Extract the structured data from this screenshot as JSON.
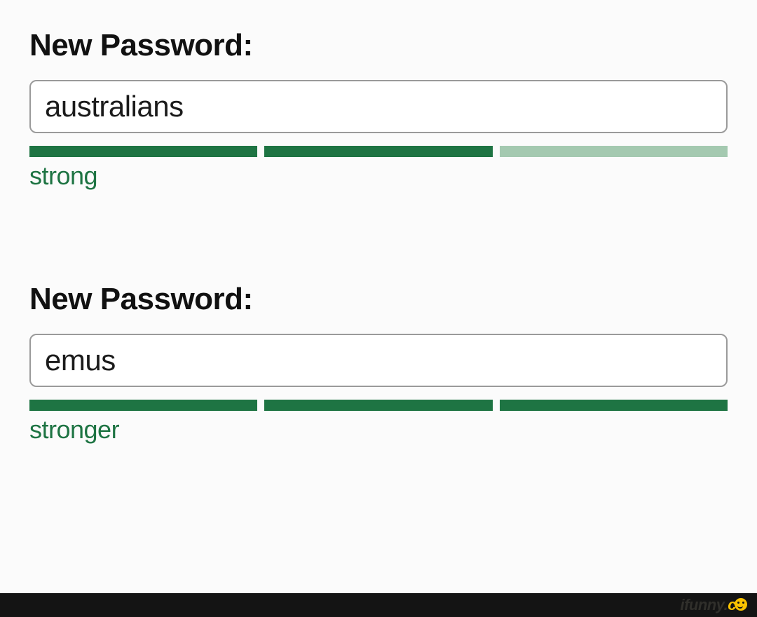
{
  "fields": [
    {
      "label": "New Password:",
      "value": "australians",
      "strength_label": "strong",
      "bars": [
        true,
        true,
        false
      ]
    },
    {
      "label": "New Password:",
      "value": "emus",
      "strength_label": "stronger",
      "bars": [
        true,
        true,
        true
      ]
    }
  ],
  "watermark": {
    "prefix": "ifunny.",
    "suffix": "c"
  },
  "colors": {
    "strong_bar": "#1e7443",
    "weak_bar": "#a4c9b0",
    "strength_text": "#1e7443",
    "watermark_yellow": "#fac300"
  }
}
